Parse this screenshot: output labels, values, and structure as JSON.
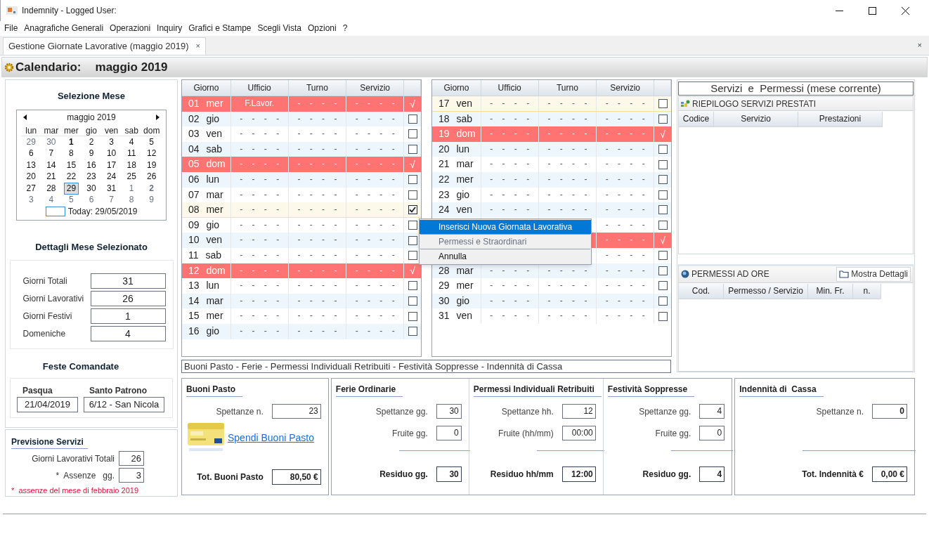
{
  "window": {
    "title": "Indemnity - Logged User:"
  },
  "menu": [
    "File",
    "Anagrafiche Generali",
    "Operazioni",
    "Inquiry",
    "Grafici e Stampe",
    "Scegli Vista",
    "Opzioni",
    "?"
  ],
  "tabs": [
    {
      "label": "Gestione Giornate Lavorative (maggio 2019)",
      "selected": true,
      "close": "×"
    }
  ],
  "tab_strip_close": "×",
  "header": {
    "label": "Calendario:",
    "month": "maggio 2019"
  },
  "month_selection": {
    "title": "Selezione Mese",
    "calendar": {
      "month": "maggio 2019",
      "weekdays": [
        "lun",
        "mar",
        "mer",
        "gio",
        "ven",
        "sab",
        "dom"
      ],
      "today": "Today: 29/05/2019",
      "weeks": [
        [
          {
            "d": "29",
            "other": true,
            "bold": false,
            "selected": false
          },
          {
            "d": "30",
            "other": true,
            "bold": false,
            "selected": false
          },
          {
            "d": "1",
            "other": false,
            "bold": true,
            "selected": false
          },
          {
            "d": "2",
            "other": false,
            "bold": false,
            "selected": false
          },
          {
            "d": "3",
            "other": false,
            "bold": false,
            "selected": false
          },
          {
            "d": "4",
            "other": false,
            "bold": false,
            "selected": false
          },
          {
            "d": "5",
            "other": false,
            "bold": false,
            "selected": false
          }
        ],
        [
          {
            "d": "6",
            "other": false,
            "bold": false,
            "selected": false
          },
          {
            "d": "7",
            "other": false,
            "bold": false,
            "selected": false
          },
          {
            "d": "8",
            "other": false,
            "bold": false,
            "selected": false
          },
          {
            "d": "9",
            "other": false,
            "bold": false,
            "selected": false
          },
          {
            "d": "10",
            "other": false,
            "bold": false,
            "selected": false
          },
          {
            "d": "11",
            "other": false,
            "bold": false,
            "selected": false
          },
          {
            "d": "12",
            "other": false,
            "bold": false,
            "selected": false
          }
        ],
        [
          {
            "d": "13",
            "other": false,
            "bold": false,
            "selected": false
          },
          {
            "d": "14",
            "other": false,
            "bold": false,
            "selected": false
          },
          {
            "d": "15",
            "other": false,
            "bold": false,
            "selected": false
          },
          {
            "d": "16",
            "other": false,
            "bold": false,
            "selected": false
          },
          {
            "d": "17",
            "other": false,
            "bold": false,
            "selected": false
          },
          {
            "d": "18",
            "other": false,
            "bold": false,
            "selected": false
          },
          {
            "d": "19",
            "other": false,
            "bold": false,
            "selected": false
          }
        ],
        [
          {
            "d": "20",
            "other": false,
            "bold": false,
            "selected": false
          },
          {
            "d": "21",
            "other": false,
            "bold": false,
            "selected": false
          },
          {
            "d": "22",
            "other": false,
            "bold": false,
            "selected": false
          },
          {
            "d": "23",
            "other": false,
            "bold": false,
            "selected": false
          },
          {
            "d": "24",
            "other": false,
            "bold": false,
            "selected": false
          },
          {
            "d": "25",
            "other": false,
            "bold": false,
            "selected": false
          },
          {
            "d": "26",
            "other": false,
            "bold": false,
            "selected": false
          }
        ],
        [
          {
            "d": "27",
            "other": false,
            "bold": false,
            "selected": false
          },
          {
            "d": "28",
            "other": false,
            "bold": false,
            "selected": false
          },
          {
            "d": "29",
            "other": false,
            "bold": false,
            "selected": true
          },
          {
            "d": "30",
            "other": false,
            "bold": false,
            "selected": false
          },
          {
            "d": "31",
            "other": false,
            "bold": false,
            "selected": false
          },
          {
            "d": "1",
            "other": true,
            "bold": false,
            "selected": false
          },
          {
            "d": "2",
            "other": true,
            "bold": true,
            "selected": false
          }
        ],
        [
          {
            "d": "3",
            "other": true,
            "bold": false,
            "selected": false
          },
          {
            "d": "4",
            "other": true,
            "bold": false,
            "selected": false
          },
          {
            "d": "5",
            "other": true,
            "bold": false,
            "selected": false
          },
          {
            "d": "6",
            "other": true,
            "bold": false,
            "selected": false
          },
          {
            "d": "7",
            "other": true,
            "bold": false,
            "selected": false
          },
          {
            "d": "8",
            "other": true,
            "bold": false,
            "selected": false
          },
          {
            "d": "9",
            "other": true,
            "bold": false,
            "selected": false
          }
        ]
      ]
    }
  },
  "month_details": {
    "title": "Dettagli Mese Selezionato",
    "rows": [
      {
        "label": "Giorni Totali",
        "value": "31"
      },
      {
        "label": "Giorni Lavorativi",
        "value": "26"
      },
      {
        "label": "Giorni Festivi",
        "value": "1"
      },
      {
        "label": "Domeniche",
        "value": "4"
      }
    ]
  },
  "holidays": {
    "title": "Feste Comandate",
    "fields": [
      {
        "label": "Pasqua",
        "value": "21/04/2019"
      },
      {
        "label": "Santo Patrono",
        "value": "6/12 - San Nicola"
      }
    ]
  },
  "forecast": {
    "title": "Previsione Servizi",
    "rows": [
      {
        "label": "Giorni Lavorativi Totali",
        "value": "26"
      },
      {
        "label": "*  Assenze   gg.",
        "value": "3"
      }
    ],
    "note": "*  assenze del mese di febbraio 2019"
  },
  "tables": [
    {
      "columns": [
        "Giorno",
        "Ufficio",
        "Turno",
        "Servizio"
      ],
      "rows": [
        {
          "cells": [
            "01 mer",
            "F.Lavor.",
            "- - - -",
            "- - - -"
          ],
          "holiday": true,
          "highlighted": false,
          "mark": "√"
        },
        {
          "cells": [
            "02 gio",
            "- - - -",
            "- - - -",
            "- - - -"
          ],
          "holiday": false,
          "highlighted": false,
          "checked": false
        },
        {
          "cells": [
            "03 ven",
            "- - - -",
            "- - - -",
            "- - - -"
          ],
          "holiday": false,
          "highlighted": false,
          "checked": false
        },
        {
          "cells": [
            "04 sab",
            "- - - -",
            "- - - -",
            "- - - -"
          ],
          "holiday": false,
          "highlighted": false,
          "checked": false
        },
        {
          "cells": [
            "05 dom",
            "- - - -",
            "- - - -",
            "- - - -"
          ],
          "holiday": true,
          "highlighted": false,
          "mark": "√"
        },
        {
          "cells": [
            "06 lun",
            "- - - -",
            "- - - -",
            "- - - -"
          ],
          "holiday": false,
          "highlighted": false,
          "checked": false
        },
        {
          "cells": [
            "07 mar",
            "- - - -",
            "- - - -",
            "- - - -"
          ],
          "holiday": false,
          "highlighted": false,
          "checked": false
        },
        {
          "cells": [
            "08 mer",
            "- - - -",
            "- - - -",
            "- - - -"
          ],
          "holiday": false,
          "highlighted": true,
          "checked": true
        },
        {
          "cells": [
            "09 gio",
            "- - - -",
            "- - - -",
            "- - - -"
          ],
          "holiday": false,
          "highlighted": false,
          "checked": false
        },
        {
          "cells": [
            "10 ven",
            "- - - -",
            "- - - -",
            "- - - -"
          ],
          "holiday": false,
          "highlighted": false,
          "checked": false
        },
        {
          "cells": [
            "11 sab",
            "- - - -",
            "- - - -",
            "- - - -"
          ],
          "holiday": false,
          "highlighted": false,
          "checked": false
        },
        {
          "cells": [
            "12 dom",
            "- - - -",
            "- - - -",
            "- - - -"
          ],
          "holiday": true,
          "highlighted": false,
          "mark": "√"
        },
        {
          "cells": [
            "13 lun",
            "- - - -",
            "- - - -",
            "- - - -"
          ],
          "holiday": false,
          "highlighted": false,
          "checked": false
        },
        {
          "cells": [
            "14 mar",
            "- - - -",
            "- - - -",
            "- - - -"
          ],
          "holiday": false,
          "highlighted": false,
          "checked": false
        },
        {
          "cells": [
            "15 mer",
            "- - - -",
            "- - - -",
            "- - - -"
          ],
          "holiday": false,
          "highlighted": false,
          "checked": false
        },
        {
          "cells": [
            "16 gio",
            "- - - -",
            "- - - -",
            "- - - -"
          ],
          "holiday": false,
          "highlighted": false,
          "checked": false
        }
      ]
    },
    {
      "columns": [
        "Giorno",
        "Ufficio",
        "Turno",
        "Servizio"
      ],
      "rows": [
        {
          "cells": [
            "17 ven",
            "- - - -",
            "- - - -",
            "- - - -"
          ],
          "holiday": false,
          "highlighted": true,
          "checked": false
        },
        {
          "cells": [
            "18 sab",
            "- - - -",
            "- - - -",
            "- - - -"
          ],
          "holiday": false,
          "highlighted": false,
          "checked": false
        },
        {
          "cells": [
            "19 dom",
            "- - - -",
            "- - - -",
            "- - - -"
          ],
          "holiday": true,
          "highlighted": false,
          "mark": "√"
        },
        {
          "cells": [
            "20 lun",
            "- - - -",
            "- - - -",
            "- - - -"
          ],
          "holiday": false,
          "highlighted": false,
          "checked": false
        },
        {
          "cells": [
            "21 mar",
            "- - - -",
            "- - - -",
            "- - - -"
          ],
          "holiday": false,
          "highlighted": false,
          "checked": false
        },
        {
          "cells": [
            "22 mer",
            "- - - -",
            "- - - -",
            "- - - -"
          ],
          "holiday": false,
          "highlighted": false,
          "checked": false
        },
        {
          "cells": [
            "23 gio",
            "- - - -",
            "- - - -",
            "- - - -"
          ],
          "holiday": false,
          "highlighted": false,
          "checked": false
        },
        {
          "cells": [
            "24 ven",
            "- - - -",
            "- - - -",
            "- - - -"
          ],
          "holiday": false,
          "highlighted": false,
          "checked": false
        },
        {
          "cells": [
            null,
            null,
            null,
            "- - - -"
          ],
          "holiday": false,
          "highlighted": false,
          "checked": false
        },
        {
          "cells": [
            null,
            null,
            null,
            "- - - -"
          ],
          "holiday": true,
          "highlighted": false,
          "mark": "√"
        },
        {
          "cells": [
            null,
            null,
            null,
            "- - - -"
          ],
          "holiday": false,
          "highlighted": false,
          "checked": false
        },
        {
          "cells": [
            "28 mar",
            "- - - -",
            "- - - -",
            "- - - -"
          ],
          "holiday": false,
          "highlighted": false,
          "checked": false
        },
        {
          "cells": [
            "29 mer",
            "- - - -",
            "- - - -",
            "- - - -"
          ],
          "holiday": false,
          "highlighted": false,
          "checked": false
        },
        {
          "cells": [
            "30 gio",
            "- - - -",
            "- - - -",
            "- - - -"
          ],
          "holiday": false,
          "highlighted": false,
          "checked": false
        },
        {
          "cells": [
            "31 ven",
            "- - - -",
            "- - - -",
            "- - - -"
          ],
          "holiday": false,
          "highlighted": false,
          "checked": false
        }
      ]
    }
  ],
  "context_menu": [
    {
      "label": "Inserisci Nuova Giornata Lavorativa",
      "selected": true,
      "disabled": false
    },
    {
      "label": "Permessi e Straordinari",
      "selected": false,
      "disabled": true
    },
    {
      "label": "Annulla",
      "selected": false,
      "disabled": false
    }
  ],
  "strip_label": "Buoni Pasto - Ferie - Permessi Individuali Retribuiti - Festività Soppresse - Indennità di Cassa",
  "summary": {
    "title": "Servizi  e  Permessi (mese corrente)",
    "sections": [
      {
        "title": "RIEPILOGO SERVIZI PRESTATI",
        "columns": [
          "Codice",
          "Servizio",
          "Prestazioni"
        ]
      },
      {
        "title": "PERMESSI AD ORE",
        "button": "Mostra Dettagli",
        "columns": [
          "Cod.",
          "Permesso / Servizio",
          "Min. Fr.",
          "n."
        ]
      }
    ]
  },
  "bottom_panels": [
    {
      "sections": [
        {
          "title": "Buoni Pasto",
          "fields": [
            {
              "label": "Spettanze n.",
              "value": "23",
              "bold": false
            }
          ],
          "link": "Spendi Buoni Pasto",
          "total": {
            "label": "Tot. Buoni Pasto",
            "value": "80,50 €"
          }
        }
      ]
    },
    {
      "sections": [
        {
          "title": "Ferie Ordinarie",
          "fields": [
            {
              "label": "Spettanze gg.",
              "value": "30",
              "bold": false
            },
            {
              "label": "Fruite gg.",
              "value": "0",
              "bold": false
            }
          ],
          "total": {
            "label": "Residuo gg.",
            "value": "30"
          }
        },
        {
          "title": "Permessi Individuali Retribuiti",
          "fields": [
            {
              "label": "Spettanze hh.",
              "value": "12",
              "bold": false
            },
            {
              "label": "Fruite (hh/mm)",
              "value": "00:00",
              "bold": false
            }
          ],
          "total": {
            "label": "Residuo hh/mm",
            "value": "12:00"
          }
        },
        {
          "title": "Festività Soppresse",
          "fields": [
            {
              "label": "Spettanze gg.",
              "value": "4",
              "bold": false
            },
            {
              "label": "Fruite gg.",
              "value": "0",
              "bold": false
            }
          ],
          "total": {
            "label": "Residuo gg.",
            "value": "4"
          }
        }
      ]
    },
    {
      "sections": [
        {
          "title": "Indennità di  Cassa",
          "fields": [
            {
              "label": "Spettanze n.",
              "value": "0",
              "bold": true
            }
          ],
          "total": {
            "label": "Tot. Indennità €",
            "value": "0,00 €"
          }
        }
      ]
    }
  ]
}
